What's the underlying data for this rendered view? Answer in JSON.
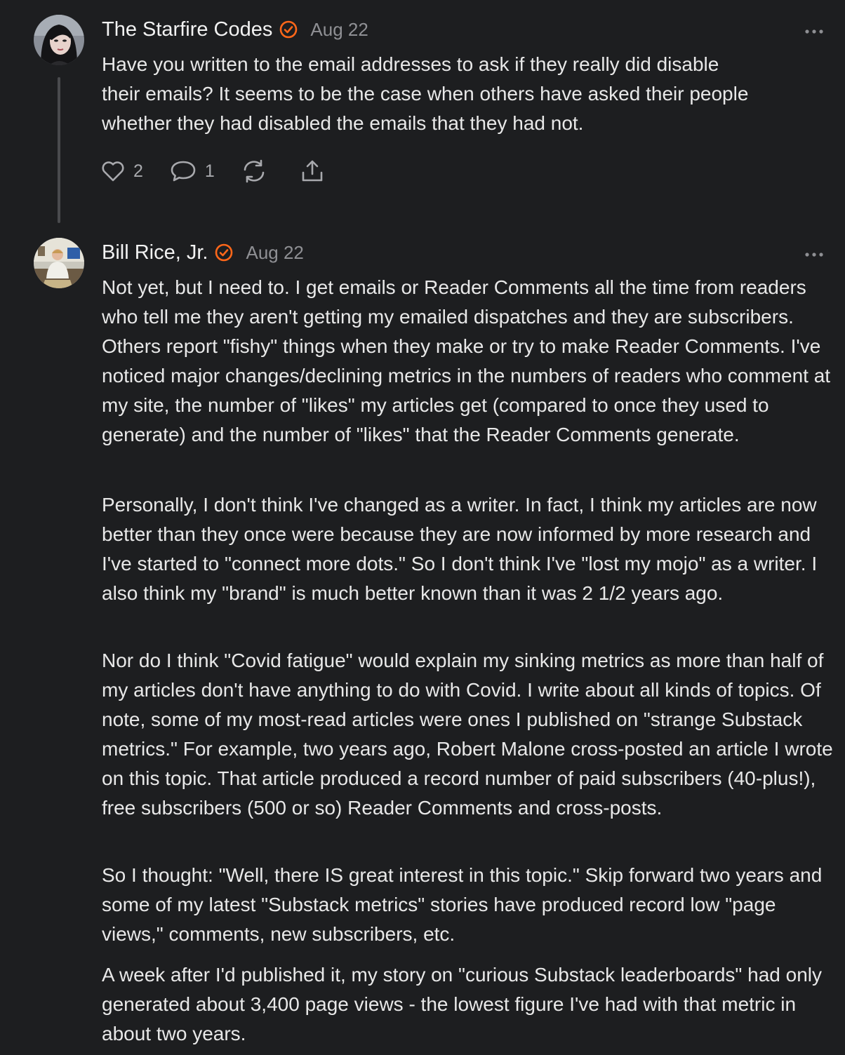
{
  "comment1": {
    "author": "The Starfire Codes",
    "date": "Aug 22",
    "body_lines": [
      "Have you written to the email addresses to ask if they really did disable",
      "their emails? It seems to be the case when others have asked their people",
      "whether they had disabled the emails that they had not."
    ],
    "like_count": "2",
    "reply_count": "1"
  },
  "comment2": {
    "author": "Bill Rice, Jr.",
    "date": "Aug 22",
    "paragraphs": [
      "Not yet, but I need to. I get emails or Reader Comments all the time from readers who tell me they aren't getting my emailed dispatches and they are subscribers. Others report \"fishy\" things when they make or try to make Reader Comments. I've noticed major changes/declining metrics in the numbers of readers who comment at my site, the number of \"likes\" my articles get (compared to once they used to generate) and the number of \"likes\" that the Reader Comments generate.",
      "Personally, I don't think I've changed as a writer. In fact, I think my articles are now better than they once were because they are now informed by more research and I've started to \"connect more dots.\" So I don't think I've \"lost my mojo\" as a writer. I also think my \"brand\" is much better known than it was 2 1/2 years ago.",
      "Nor do I think \"Covid fatigue\" would explain my sinking metrics as more than half of my articles don't have anything to do with Covid. I write about all kinds of topics. Of note, some of my most-read articles were ones I published on \"strange Substack metrics.\" For example, two years ago, Robert Malone cross-posted an article I wrote on this topic. That article produced a record number of paid subscribers (40-plus!), free subscribers (500 or so) Reader Comments and cross-posts.",
      "So I thought: \"Well, there IS great interest in this topic.\" Skip forward two years and some of my latest \"Substack metrics\" stories have produced record low \"page views,\" comments, new subscribers, etc.",
      "A week after I'd published it, my story on \"curious Substack leaderboards\" had only generated about 3,400 page views - the lowest figure I've had with that metric in about two years."
    ]
  },
  "colors": {
    "background": "#1d1e20",
    "accent": "#ff6719",
    "muted": "#8f9094"
  },
  "icons": [
    "heart-icon",
    "comment-icon",
    "restack-icon",
    "share-icon",
    "more-icon",
    "verified-badge-icon"
  ]
}
